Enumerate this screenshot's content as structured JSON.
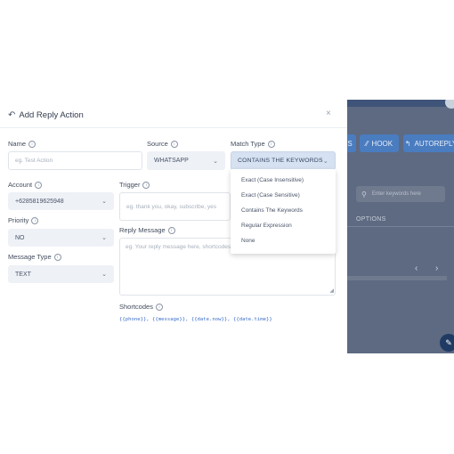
{
  "background": {
    "buttons": {
      "hook": "HOOK",
      "autoreply": "AUTOREPLY"
    },
    "search_placeholder": "Enter keywords here",
    "table_header_options": "OPTIONS",
    "pager": {
      "prev": "‹",
      "next": "›"
    }
  },
  "modal": {
    "title": "Add Reply Action",
    "close": "×",
    "fields": {
      "name": {
        "label": "Name",
        "placeholder": "eg. Test Action"
      },
      "source": {
        "label": "Source",
        "value": "WHATSAPP"
      },
      "match_type": {
        "label": "Match Type",
        "value": "CONTAINS THE KEYWORDS",
        "options": [
          "Exact (Case Insensitive)",
          "Exact (Case Sensitive)",
          "Contains The Keywords",
          "Regular Expression",
          "None"
        ]
      },
      "account": {
        "label": "Account",
        "value": "+6285819625948"
      },
      "trigger": {
        "label": "Trigger",
        "placeholder": "eg. thank you, okay, subscribe, yes"
      },
      "priority": {
        "label": "Priority",
        "value": "NO"
      },
      "reply_message": {
        "label": "Reply Message",
        "placeholder": "eg. Your reply message here, shortcodes are supported"
      },
      "message_type": {
        "label": "Message Type",
        "value": "TEXT"
      }
    },
    "shortcodes": {
      "label": "Shortcodes",
      "codes": "{{phone}}, {{message}}, {{date.now}}, {{date.time}}"
    }
  }
}
